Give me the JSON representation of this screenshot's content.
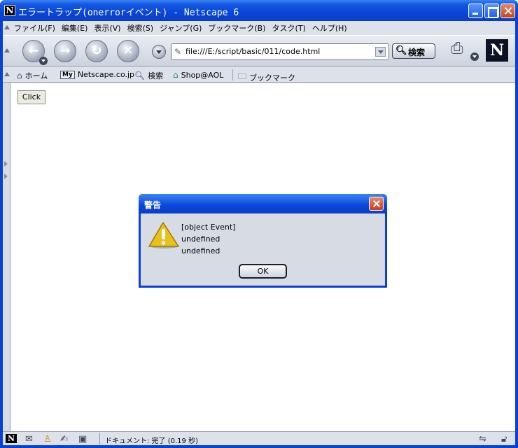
{
  "window": {
    "title": "エラートラップ(onerrorイベント) - Netscape 6"
  },
  "menu": {
    "items": [
      {
        "label": "ファイル(F)"
      },
      {
        "label": "編集(E)"
      },
      {
        "label": "表示(V)"
      },
      {
        "label": "検索(S)"
      },
      {
        "label": "ジャンプ(G)"
      },
      {
        "label": "ブックマーク(B)"
      },
      {
        "label": "タスク(T)"
      },
      {
        "label": "ヘルプ(H)"
      }
    ]
  },
  "navbar": {
    "url": "file:///E:/script/basic/011/code.html",
    "search_label": "検索",
    "logo_letter": "N"
  },
  "personal_toolbar": {
    "home": "ホーム",
    "my_badge": "My",
    "netscape": "Netscape.co.jp",
    "search": "検索",
    "shop": "Shop@AOL",
    "bookmarks": "ブックマーク"
  },
  "content": {
    "click_button": "Click"
  },
  "dialog": {
    "title": "警告",
    "lines": [
      "[object Event]",
      "undefined",
      "undefined"
    ],
    "ok_label": "OK"
  },
  "statusbar": {
    "text": "ドキュメント: 完了 (0.19 秒)"
  },
  "colors": {
    "titlebar": "#0a46d8",
    "chrome": "#d6dbe4",
    "close_red": "#c8401c"
  }
}
